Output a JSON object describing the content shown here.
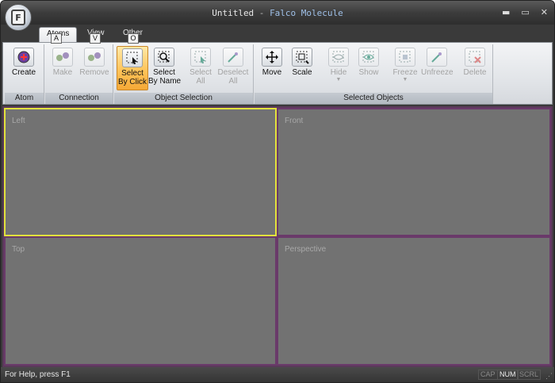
{
  "window": {
    "document_name": "Untitled",
    "separator": " - ",
    "app_name": "Falco Molecule",
    "app_button_letter": "F",
    "controls": {
      "minimize": "▬",
      "maximize": "▭",
      "close": "✕"
    }
  },
  "tabs": [
    {
      "label": "Atoms",
      "keytip": "A",
      "active": true
    },
    {
      "label": "View",
      "keytip": "V",
      "active": false
    },
    {
      "label": "Other",
      "keytip": "O",
      "active": false
    }
  ],
  "ribbon": {
    "groups": {
      "atom": {
        "label": "Atom",
        "buttons": [
          {
            "line1": "Create",
            "line2": "",
            "icon": "atom-create-icon",
            "enabled": true
          }
        ]
      },
      "connection": {
        "label": "Connection",
        "buttons": [
          {
            "line1": "Make",
            "line2": "",
            "icon": "bond-make-icon",
            "enabled": false
          },
          {
            "line1": "Remove",
            "line2": "",
            "icon": "bond-remove-icon",
            "enabled": false
          }
        ]
      },
      "object_selection": {
        "label": "Object Selection",
        "buttons": [
          {
            "line1": "Select",
            "line2": "By Click",
            "icon": "select-by-click-icon",
            "enabled": true,
            "selected": true
          },
          {
            "line1": "Select",
            "line2": "By Name",
            "icon": "select-by-name-icon",
            "enabled": true
          },
          {
            "line1": "Select",
            "line2": "All",
            "icon": "select-all-icon",
            "enabled": false
          },
          {
            "line1": "Deselect",
            "line2": "All",
            "icon": "deselect-all-icon",
            "enabled": false
          }
        ]
      },
      "selected_objects": {
        "label": "Selected Objects",
        "buttons": [
          {
            "line1": "Move",
            "line2": "",
            "icon": "move-icon",
            "enabled": true
          },
          {
            "line1": "Scale",
            "line2": "",
            "icon": "scale-icon",
            "enabled": true
          },
          {
            "line1": "Hide",
            "line2": "",
            "icon": "hide-icon",
            "enabled": false,
            "dropdown": true
          },
          {
            "line1": "Show",
            "line2": "",
            "icon": "show-icon",
            "enabled": false
          },
          {
            "line1": "Freeze",
            "line2": "",
            "icon": "freeze-icon",
            "enabled": false,
            "dropdown": true
          },
          {
            "line1": "Unfreeze",
            "line2": "",
            "icon": "unfreeze-icon",
            "enabled": false
          },
          {
            "line1": "Delete",
            "line2": "",
            "icon": "delete-icon",
            "enabled": false
          }
        ]
      }
    }
  },
  "viewports": [
    {
      "label": "Left",
      "active": true
    },
    {
      "label": "Front",
      "active": false
    },
    {
      "label": "Top",
      "active": false
    },
    {
      "label": "Perspective",
      "active": false
    }
  ],
  "status": {
    "text": "For Help, press F1",
    "indicators": [
      {
        "label": "CAP",
        "on": false
      },
      {
        "label": "NUM",
        "on": true
      },
      {
        "label": "SCRL",
        "on": false
      }
    ]
  },
  "colors": {
    "active_viewport_border": "#e2e23c",
    "viewport_border": "#6a3a6a",
    "viewport_fill": "#727272",
    "selected_button": "#ffc45a"
  }
}
